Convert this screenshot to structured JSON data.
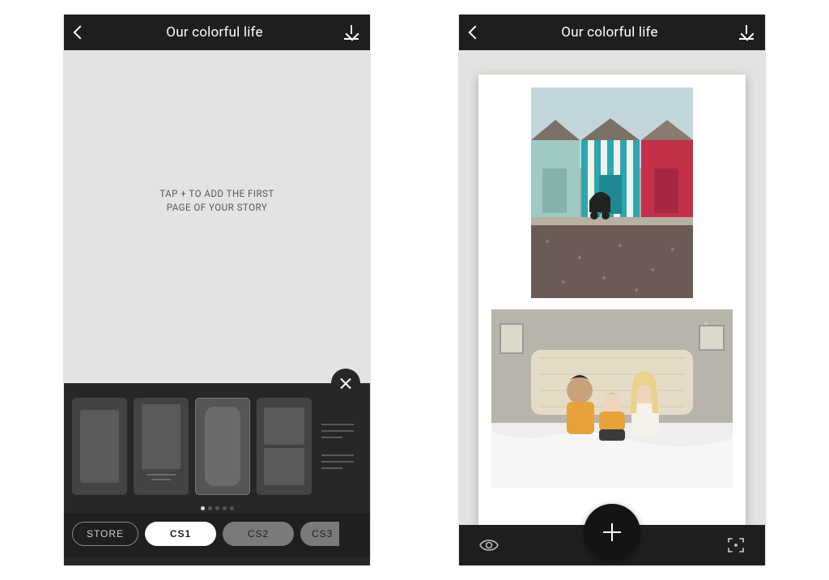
{
  "left": {
    "title": "Our colorful life",
    "empty_line1": "TAP + TO ADD THE FIRST",
    "empty_line2": "PAGE OF YOUR STORY",
    "store_label": "STORE",
    "presets": [
      "CS1",
      "CS2",
      "CS3"
    ],
    "selected_preset_index": 0,
    "page_dots": 5,
    "active_dot": 0
  },
  "right": {
    "title": "Our colorful life"
  }
}
